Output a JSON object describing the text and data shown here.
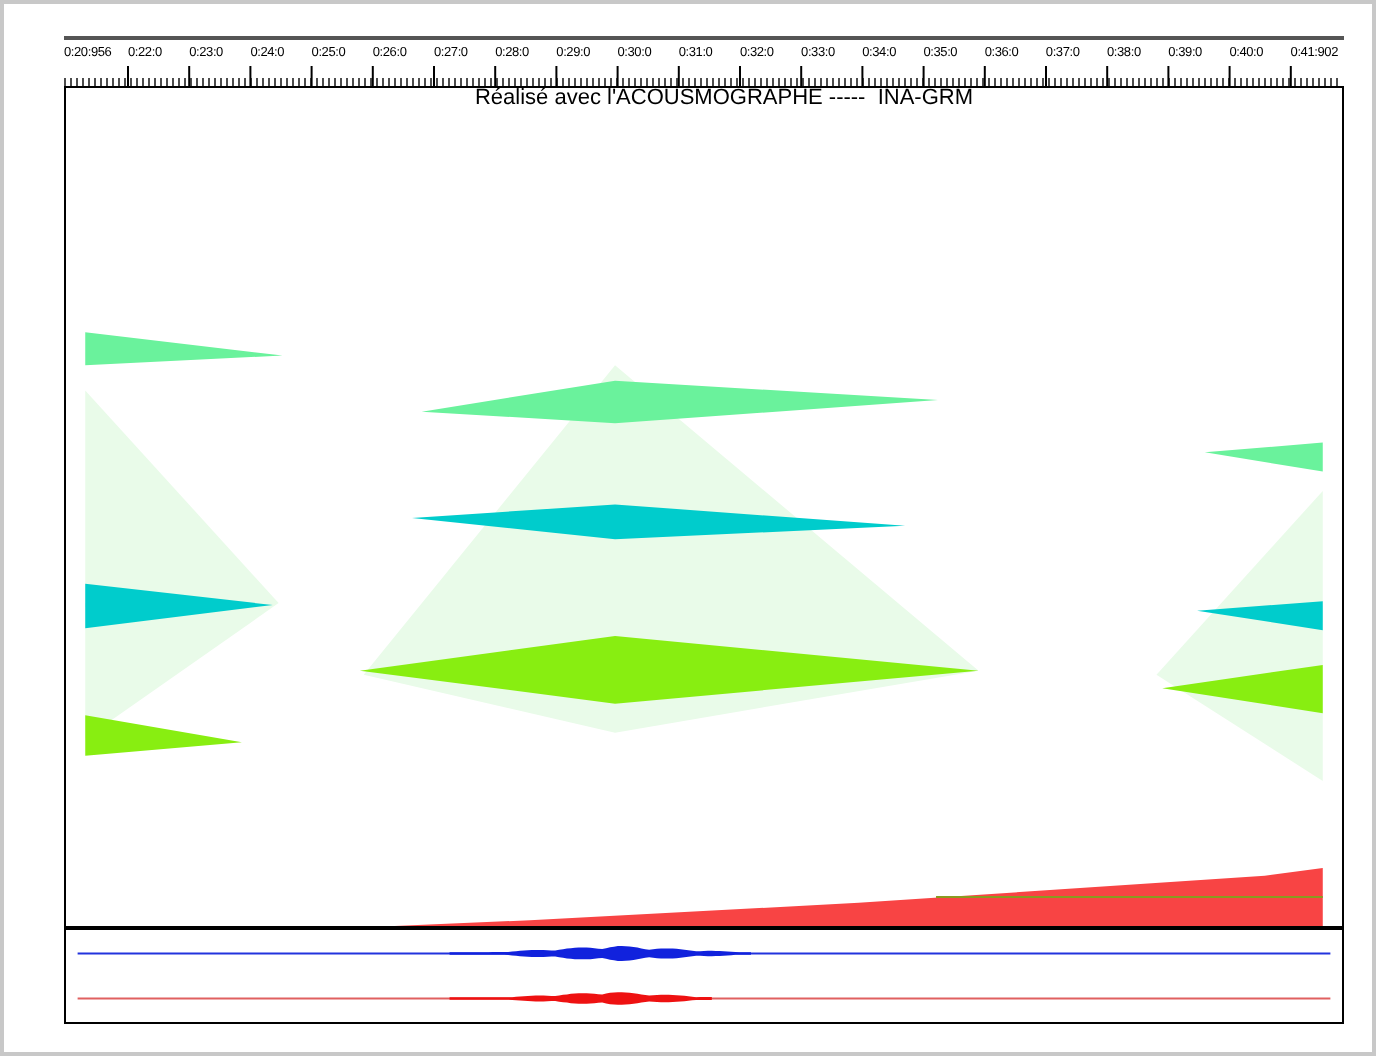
{
  "time_ruler": {
    "labels": [
      "0:20:956",
      "0:22:0",
      "0:23:0",
      "0:24:0",
      "0:25:0",
      "0:26:0",
      "0:27:0",
      "0:28:0",
      "0:29:0",
      "0:30:0",
      "0:31:0",
      "0:32:0",
      "0:33:0",
      "0:34:0",
      "0:35:0",
      "0:36:0",
      "0:37:0",
      "0:38:0",
      "0:39:0",
      "0:40:0",
      "0:41:902"
    ]
  },
  "credit": "Réalisé avec l'ACOUSMOGRAPHE -----  INA-GRM"
}
